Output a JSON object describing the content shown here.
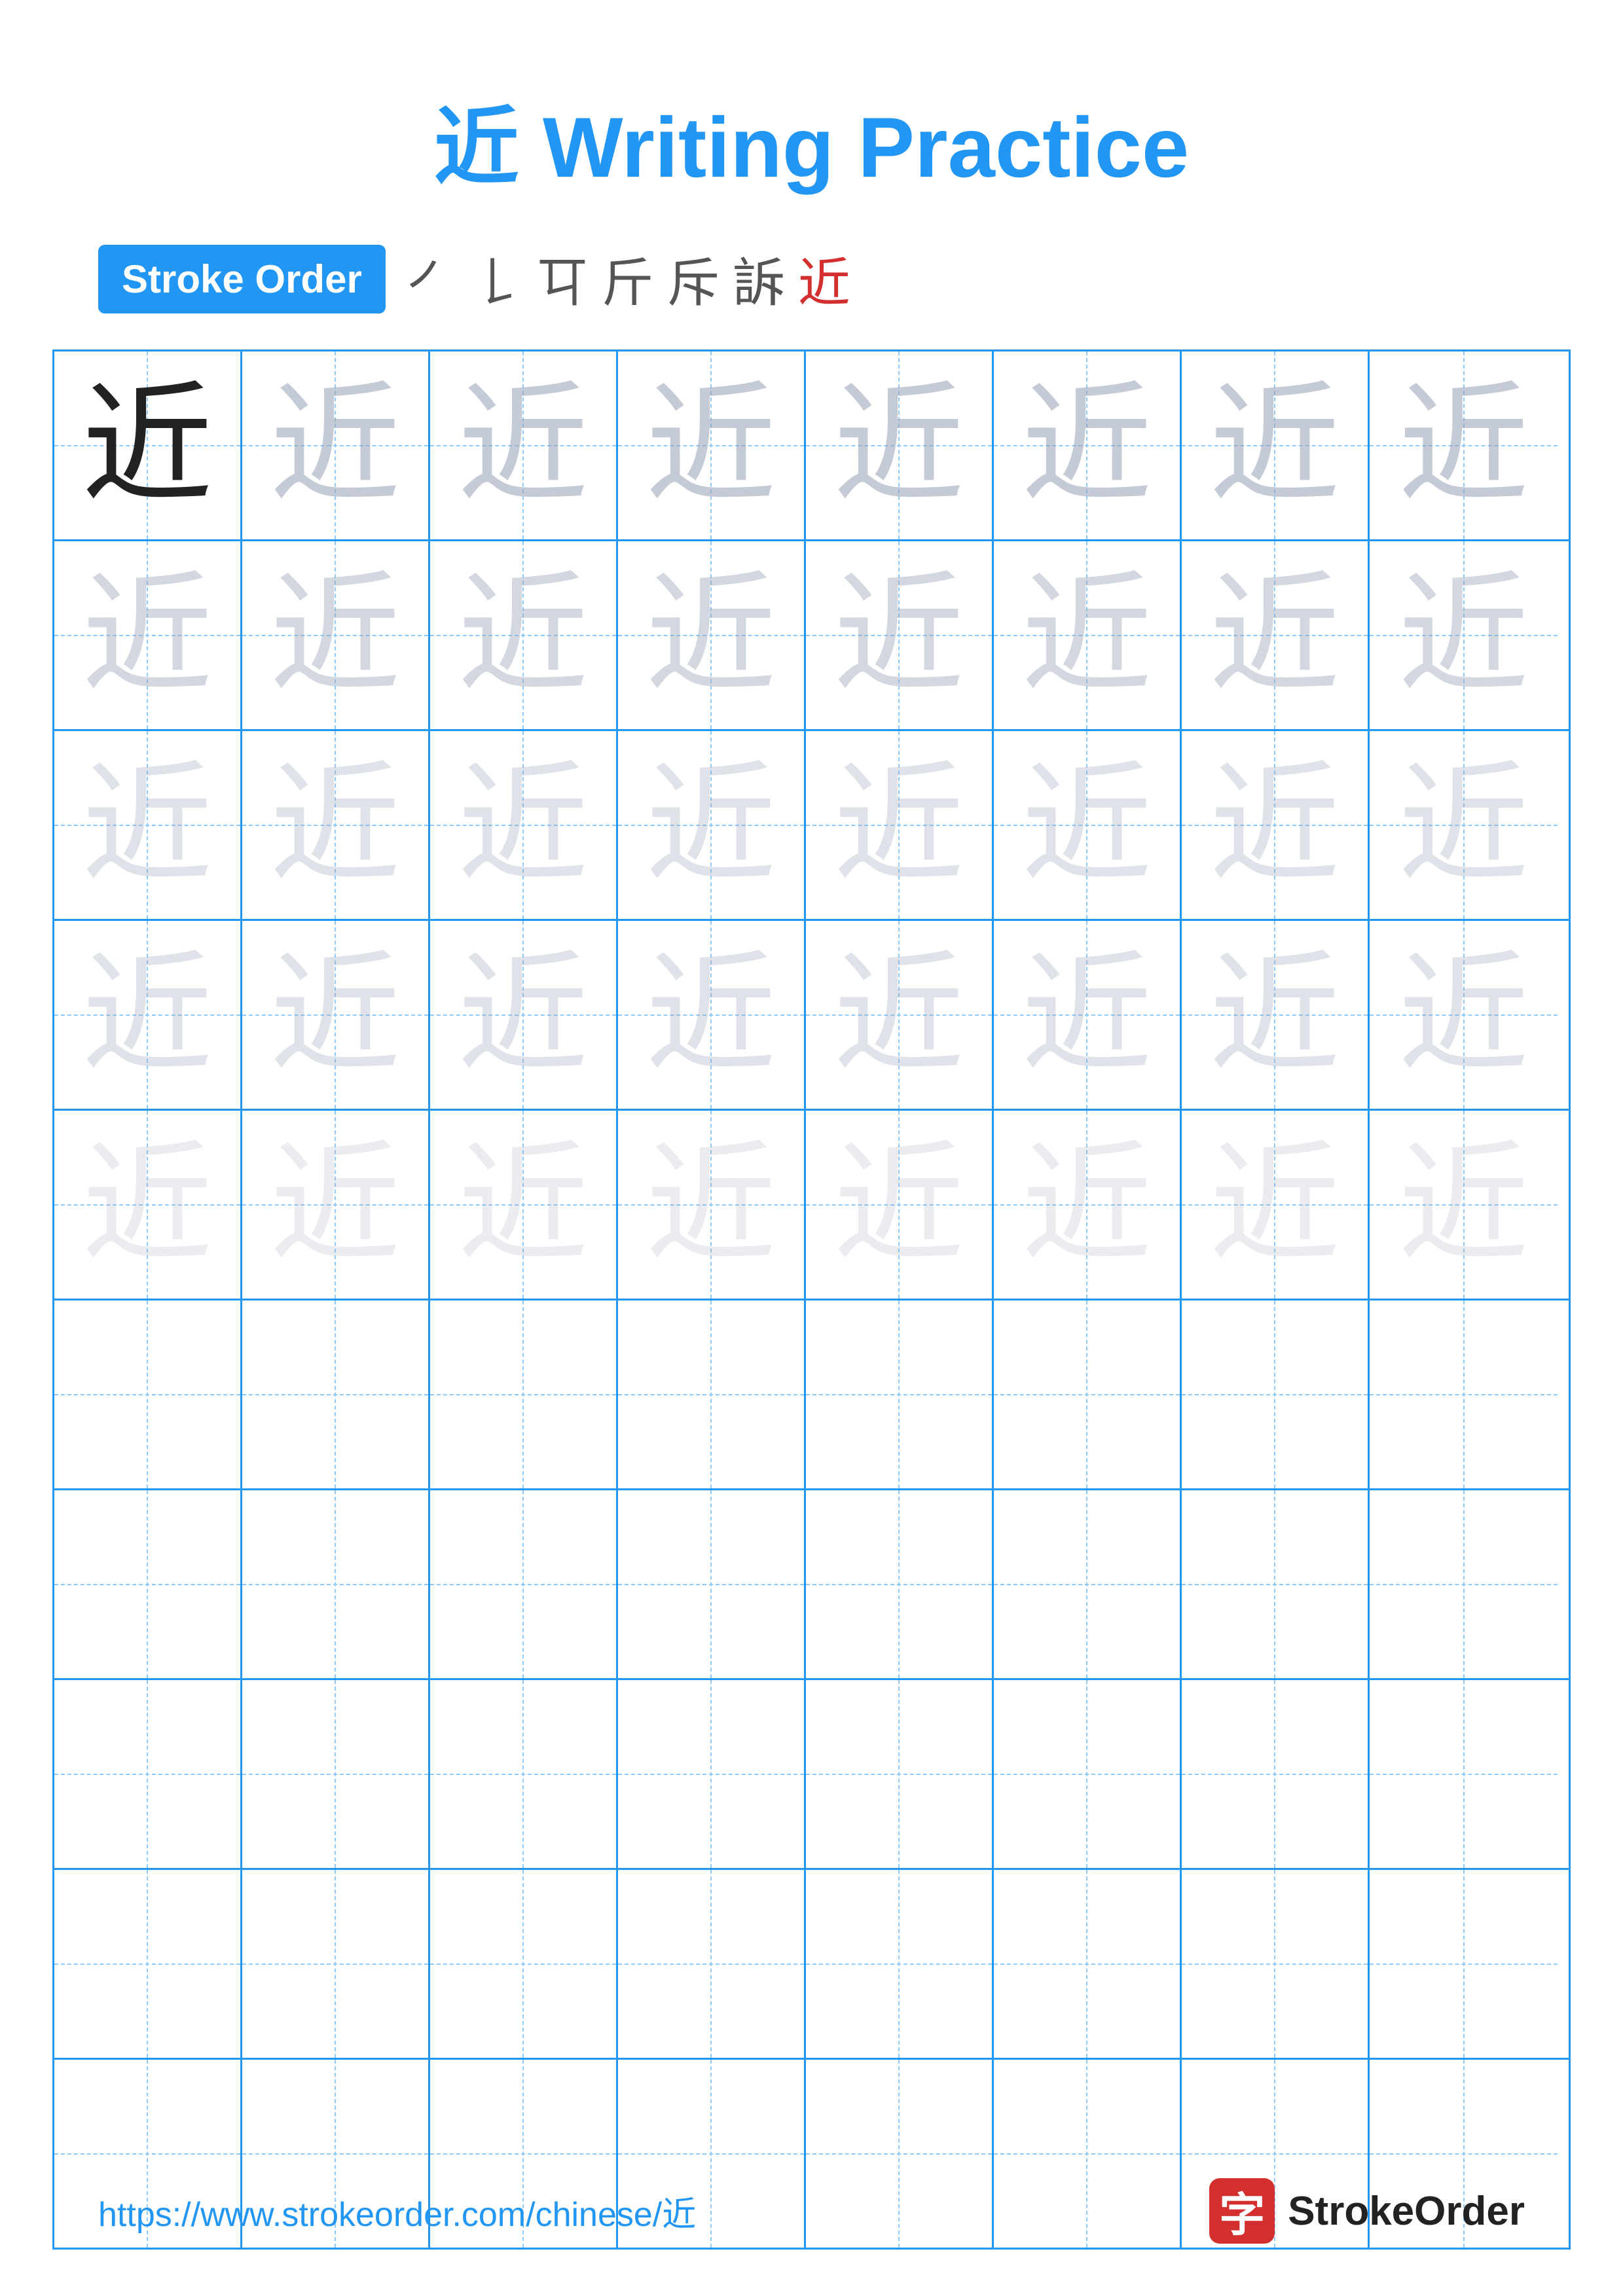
{
  "title": {
    "char": "近",
    "text": " Writing Practice"
  },
  "stroke_order": {
    "badge_label": "Stroke Order",
    "strokes": [
      "㇒",
      "㇓",
      "㇗",
      "斤",
      "斥",
      "近⁻",
      "近"
    ]
  },
  "grid": {
    "rows": 10,
    "cols": 8,
    "char": "近",
    "practice_rows": 5
  },
  "footer": {
    "url": "https://www.strokeorder.com/chinese/近",
    "logo_char": "字",
    "logo_text": "StrokeOrder"
  }
}
